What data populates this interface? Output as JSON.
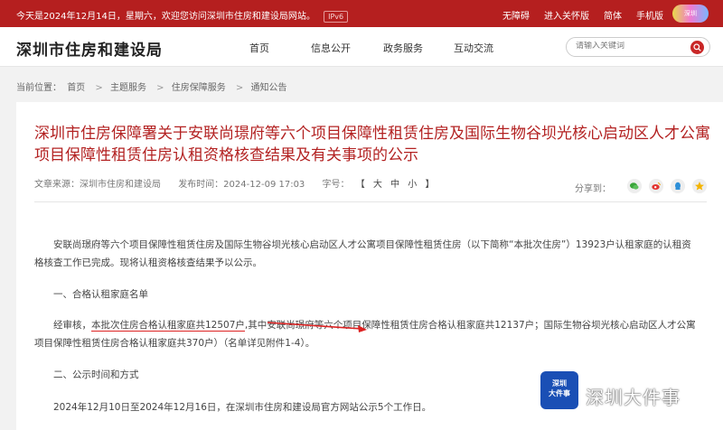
{
  "topbar": {
    "welcome": "今天是2024年12月14日，星期六，欢迎您访问深圳市住房和建设局网站。",
    "ipv6": "IPv6",
    "links": [
      "无障碍",
      "进入关怀版",
      "简体",
      "手机版"
    ],
    "logo_text": "深圳"
  },
  "header": {
    "site_title": "深圳市住房和建设局",
    "nav": [
      "首页",
      "信息公开",
      "政务服务",
      "互动交流"
    ],
    "search_placeholder": "请输入关键词"
  },
  "breadcrumb": {
    "label": "当前位置：",
    "items": [
      "首页",
      "主题服务",
      "住房保障服务",
      "通知公告"
    ],
    "separator": ">"
  },
  "article": {
    "title": "深圳市住房保障署关于安联尚璟府等六个项目保障性租赁住房及国际生物谷坝光核心启动区人才公寓项目保障性租赁住房认租资格核查结果及有关事项的公示",
    "source": "文章来源：深圳市住房和建设局",
    "published": "发布时间：2024-12-09 17:03",
    "font_size_label": "字号：",
    "font_sizes": [
      "【",
      "大",
      "中",
      "小",
      "】"
    ],
    "share_label": "分享到：",
    "share_icons": [
      "wechat-icon",
      "weibo-icon",
      "qq-icon",
      "qzone-icon"
    ],
    "para1": "安联尚璟府等六个项目保障性租赁住房及国际生物谷坝光核心启动区人才公寓项目保障性租赁住房（以下简称“本批次住房”）13923户认租家庭的认租资格核查工作已完成。现将认租资格核查结果予以公示。",
    "heading1": "一、合格认租家庭名单",
    "para2_prefix": "经审核，",
    "para2_underlined": "本批次住房合格认租家庭共12507户",
    "para2_rest": ",其中安联尚璟府等六个项目保障性租赁住房合格认租家庭共12137户；国际生物谷坝光核心启动区人才公寓项目保障性租赁住房合格认租家庭共370户）（名单详见附件1-4）。",
    "heading2": "二、公示时间和方式",
    "para3": "2024年12月10日至2024年12月16日，在深圳市住房和建设局官方网站公示5个工作日。"
  },
  "watermark": {
    "badge": "深圳\n大件事",
    "text": "深圳大件事"
  },
  "colors": {
    "topbar": "#b51f1f",
    "title": "#b32222",
    "annotation": "#d22222"
  }
}
